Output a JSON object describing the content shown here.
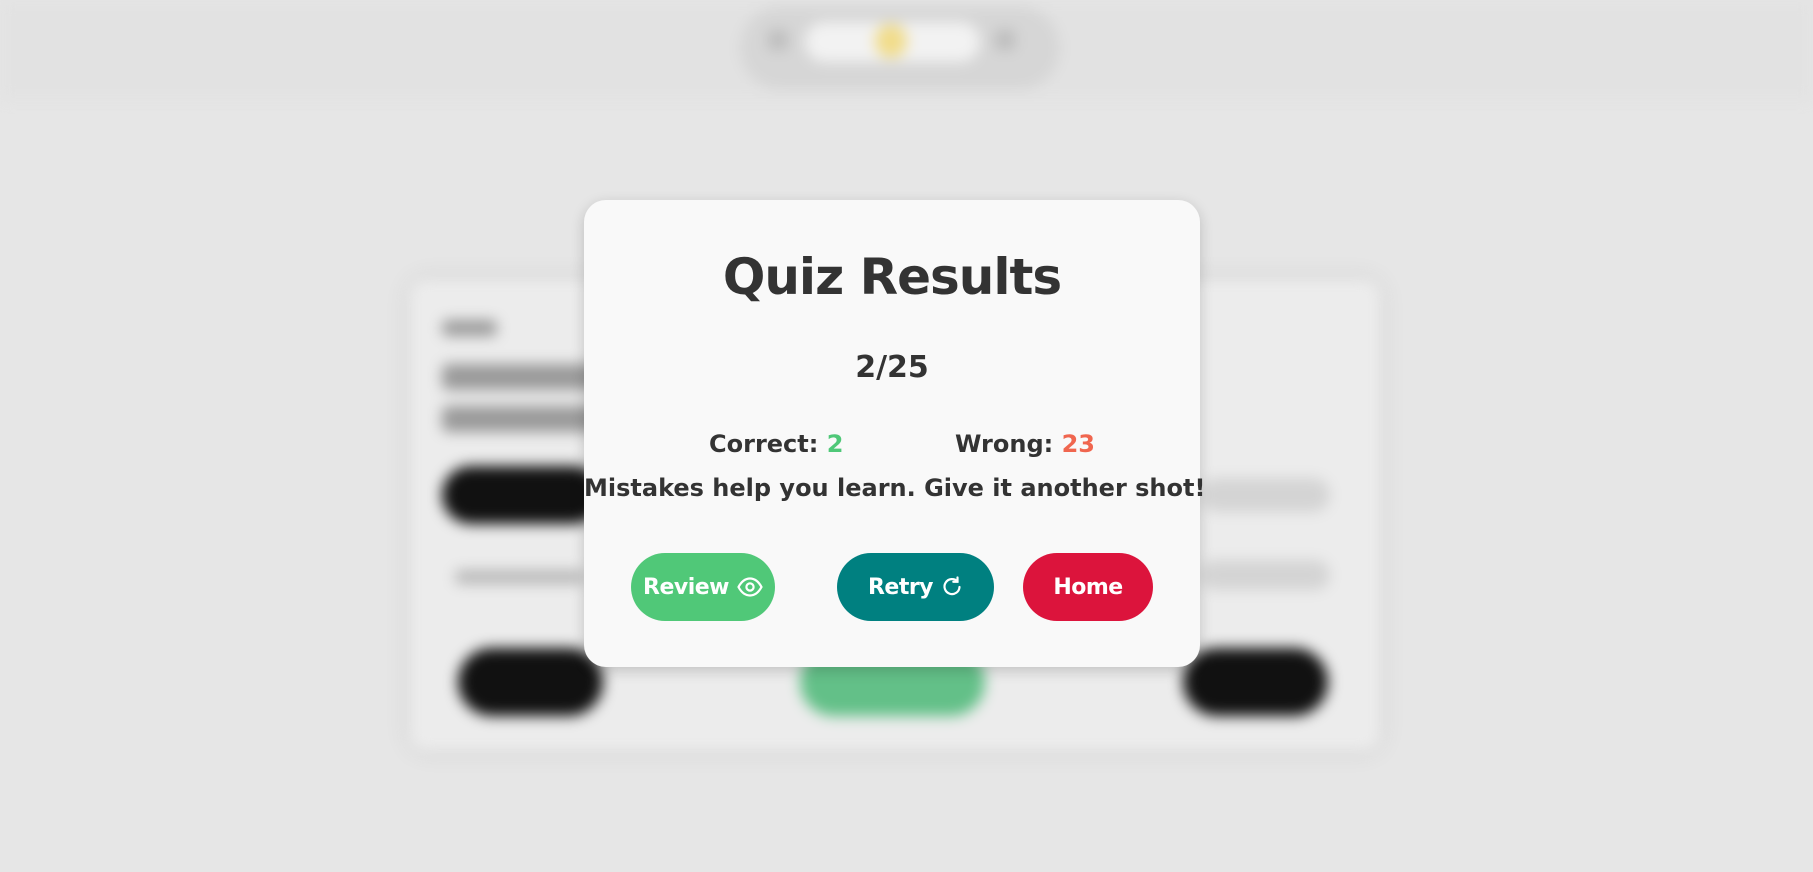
{
  "modal": {
    "title": "Quiz Results",
    "score": "2/25",
    "correct_label": "Correct:",
    "correct_value": "2",
    "wrong_label": "Wrong:",
    "wrong_value": "23",
    "message": "Mistakes help you learn. Give it another shot!",
    "buttons": {
      "review": "Review",
      "retry": "Retry",
      "home": "Home"
    }
  },
  "colors": {
    "correct": "#50c878",
    "wrong": "#f0664f",
    "review_button": "#50c878",
    "retry_button": "#008080",
    "home_button": "#dc143c"
  },
  "icons": {
    "review": "eye-icon",
    "retry": "refresh-icon"
  }
}
